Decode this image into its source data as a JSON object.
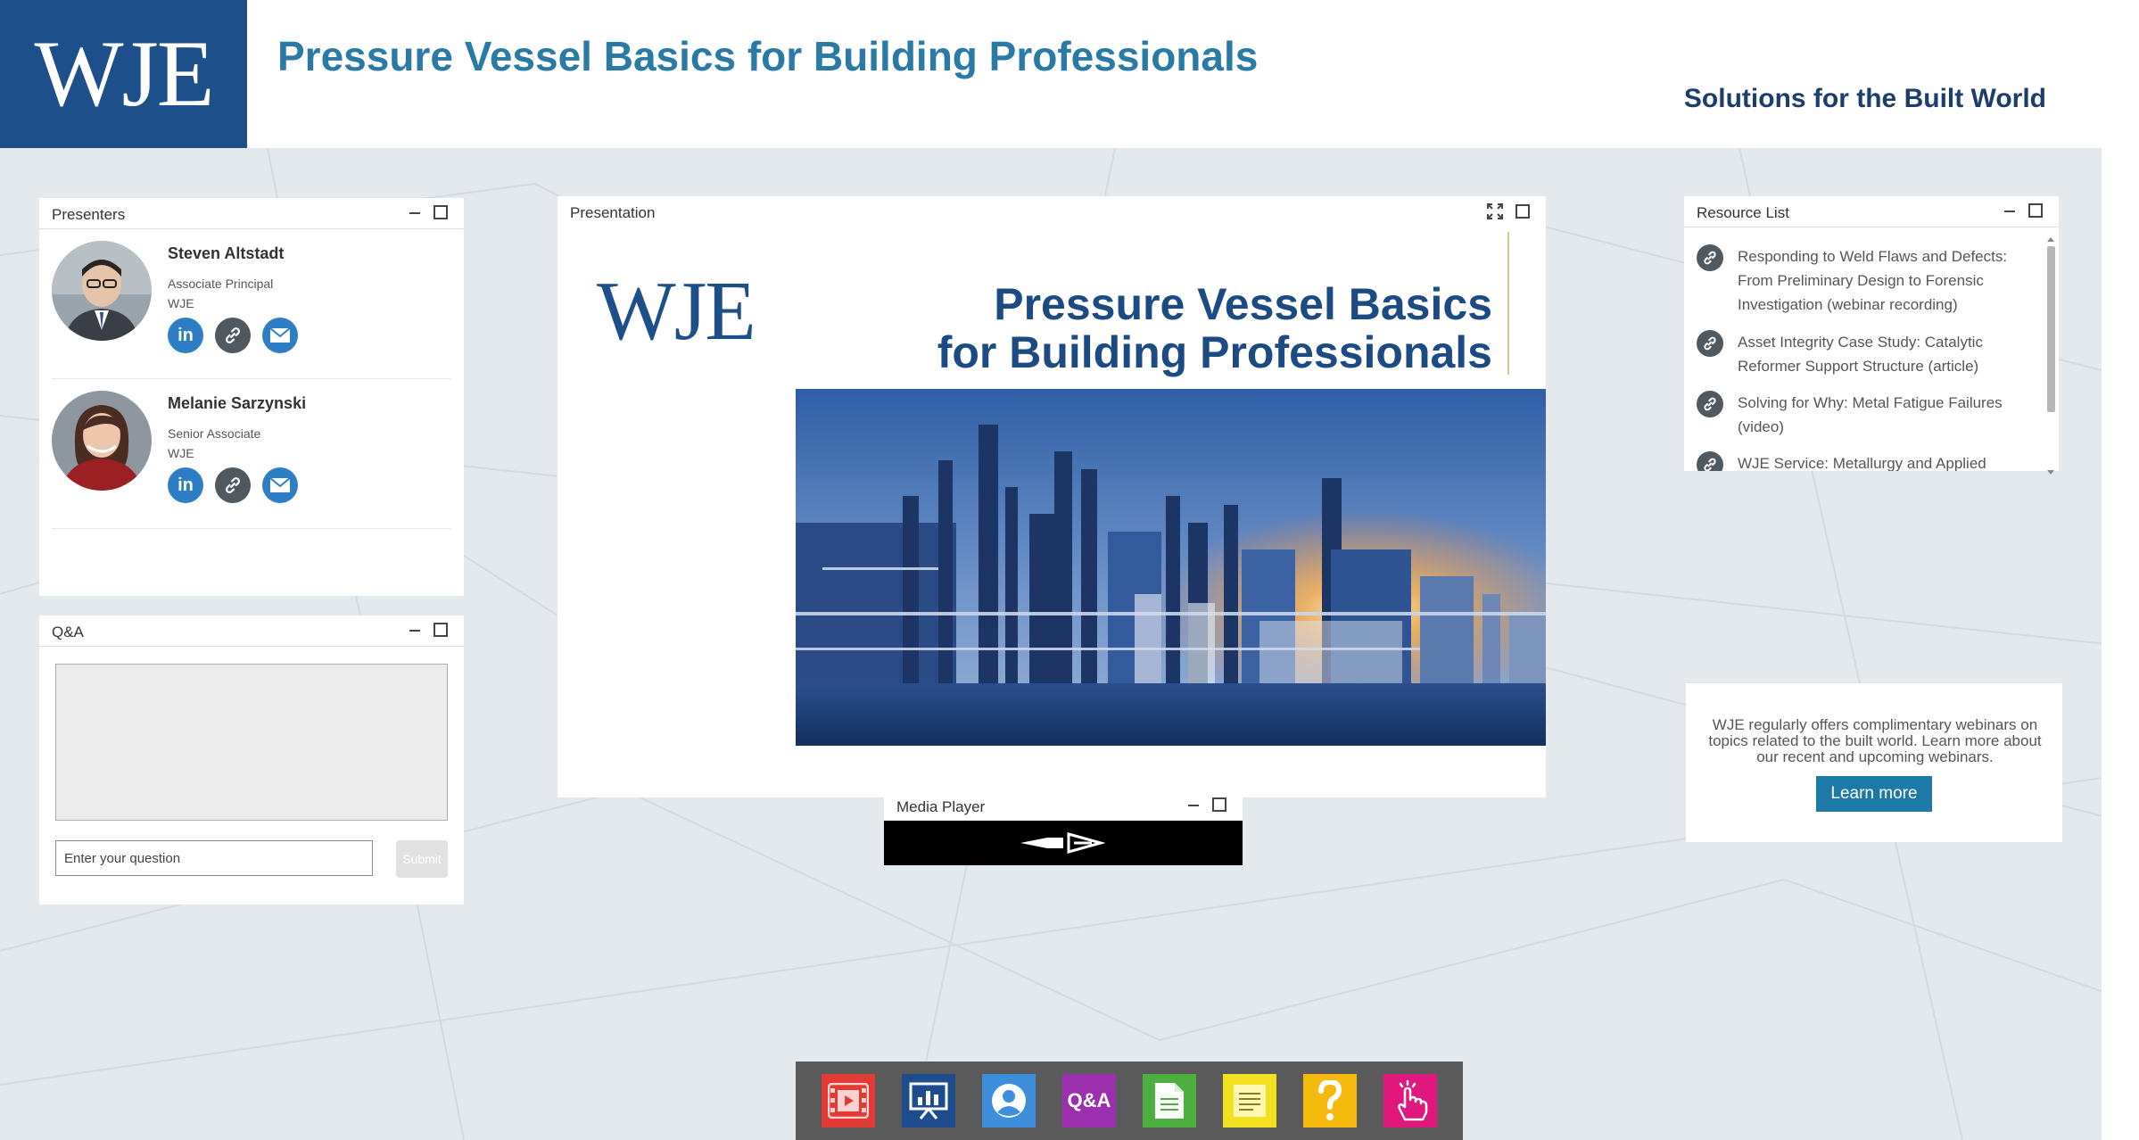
{
  "header": {
    "logo": "WJE",
    "title": "Pressure Vessel Basics for Building Professionals",
    "tagline": "Solutions for the Built World"
  },
  "presenters_panel": {
    "title": "Presenters",
    "presenters": [
      {
        "name": "Steven Altstadt",
        "role": "Associate Principal",
        "org": "WJE"
      },
      {
        "name": "Melanie Sarzynski",
        "role": "Senior Associate",
        "org": "WJE"
      }
    ]
  },
  "qa_panel": {
    "title": "Q&A",
    "input_placeholder": "Enter your question",
    "submit_label": "Submit"
  },
  "presentation_panel": {
    "title": "Presentation",
    "slide": {
      "logo": "WJE",
      "title_line1": "Pressure Vessel Basics",
      "title_line2": "for Building Professionals"
    }
  },
  "resource_panel": {
    "title": "Resource List",
    "items": [
      {
        "text": "Responding to Weld Flaws and Defects: From Preliminary Design to Forensic Investigation (webinar recording)"
      },
      {
        "text": "Asset Integrity Case Study: Catalytic Reformer Support Structure (article)"
      },
      {
        "text": "Solving for Why: Metal Fatigue Failures (video)"
      },
      {
        "text": "WJE Service: Metallurgy and Applied"
      }
    ]
  },
  "promo": {
    "text": "WJE regularly offers complimentary webinars on topics related to the built world. Learn more about our recent and upcoming webinars.",
    "button_label": "Learn more"
  },
  "media_player": {
    "title": "Media Player"
  },
  "dock": {
    "qa_label": "Q&A",
    "buttons": [
      {
        "name": "media-player",
        "color": "#e23b35"
      },
      {
        "name": "presentation",
        "color": "#1e4d8e"
      },
      {
        "name": "presenters",
        "color": "#3d8fdc"
      },
      {
        "name": "qa",
        "color": "#9b2fae"
      },
      {
        "name": "resources",
        "color": "#4caf3f"
      },
      {
        "name": "notes",
        "color": "#f2e220"
      },
      {
        "name": "help",
        "color": "#f6b90d"
      },
      {
        "name": "engagement",
        "color": "#e0187d"
      }
    ]
  },
  "colors": {
    "brand_navy": "#1d4f8a",
    "title_teal": "#2a7aa6",
    "button_blue": "#1d7aa6"
  }
}
